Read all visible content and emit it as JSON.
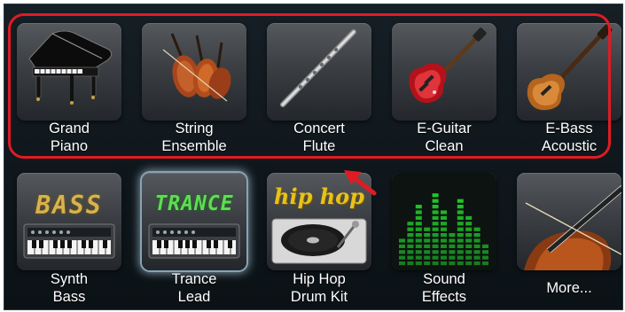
{
  "colors": {
    "panel_bg": "#131b21",
    "highlight": "#e01b24",
    "label": "#ffffff",
    "bass_text": "#d9b34a",
    "trance_text": "#5fdc55",
    "hiphop_text": "#e8c21c",
    "equalizer": "#22d12c"
  },
  "instruments": [
    {
      "line1": "Grand",
      "line2": "Piano",
      "icon": "grand-piano-icon"
    },
    {
      "line1": "String",
      "line2": "Ensemble",
      "icon": "string-ensemble-icon"
    },
    {
      "line1": "Concert",
      "line2": "Flute",
      "icon": "flute-icon"
    },
    {
      "line1": "E-Guitar",
      "line2": "Clean",
      "icon": "electric-guitar-icon"
    },
    {
      "line1": "E-Bass",
      "line2": "Acoustic",
      "icon": "bass-guitar-icon"
    },
    {
      "line1": "Synth",
      "line2": "Bass",
      "icon": "synth-bass-icon",
      "tile_text": "BASS"
    },
    {
      "line1": "Trance",
      "line2": "Lead",
      "icon": "trance-synth-icon",
      "tile_text": "TRANCE",
      "selected": true
    },
    {
      "line1": "Hip Hop",
      "line2": "Drum Kit",
      "icon": "turntable-icon",
      "tile_text": "hip hop"
    },
    {
      "line1": "Sound",
      "line2": "Effects",
      "icon": "equalizer-icon"
    },
    {
      "line1": "More...",
      "line2": "",
      "icon": "violin-icon"
    }
  ]
}
